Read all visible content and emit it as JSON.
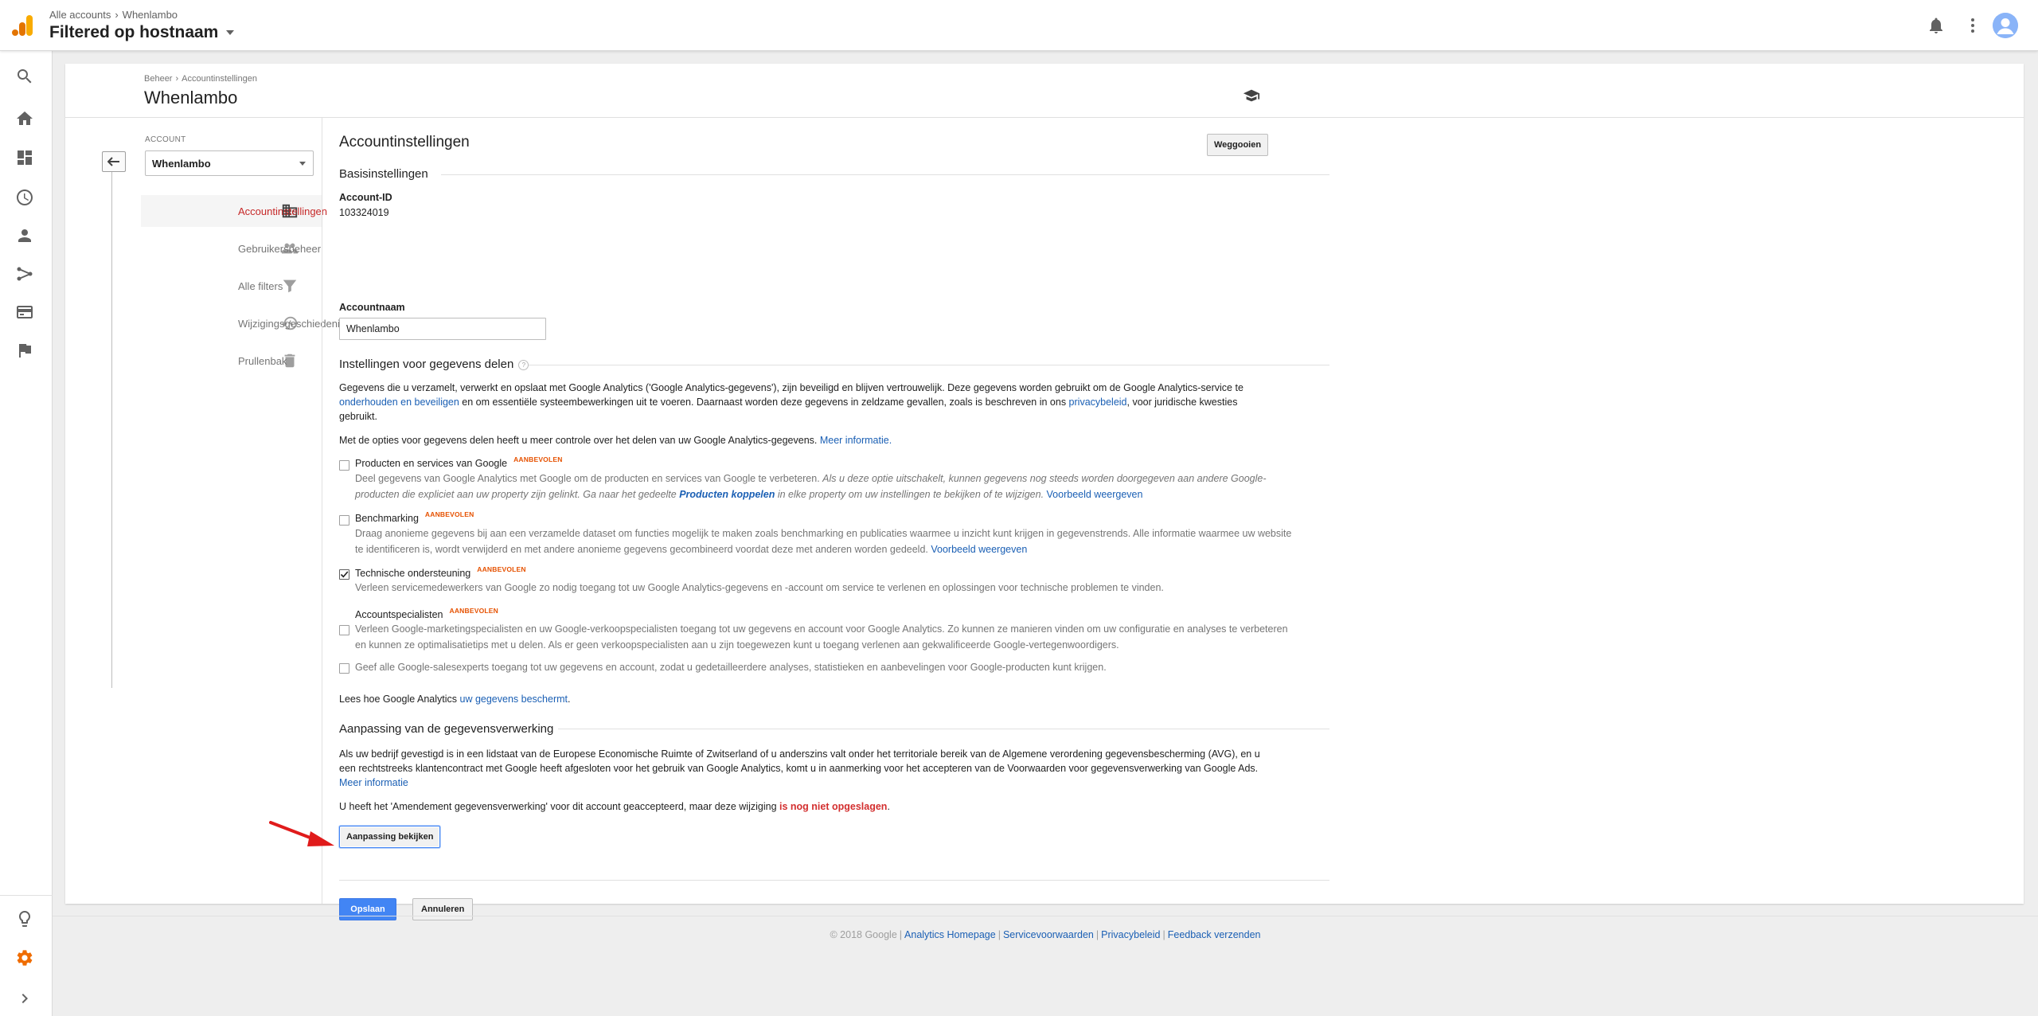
{
  "header": {
    "breadcrumb": [
      "Alle accounts",
      "Whenlambo"
    ],
    "view_title": "Filtered op hostnaam"
  },
  "admin": {
    "breadcrumb": [
      "Beheer",
      "Accountinstellingen"
    ],
    "title": "Whenlambo"
  },
  "account_column": {
    "label": "ACCOUNT",
    "selected": "Whenlambo",
    "menu": [
      {
        "label": "Accountinstellingen",
        "icon": "building-icon",
        "active": true
      },
      {
        "label": "Gebruikersbeheer",
        "icon": "users-icon",
        "active": false
      },
      {
        "label": "Alle filters",
        "icon": "filter-icon",
        "active": false
      },
      {
        "label": "Wijzigingsgeschiedenis",
        "icon": "history-icon",
        "active": false
      },
      {
        "label": "Prullenbak",
        "icon": "trash-icon",
        "active": false
      }
    ]
  },
  "settings": {
    "title": "Accountinstellingen",
    "delete_button": "Weggooien",
    "basic_section": "Basisinstellingen",
    "account_id_label": "Account-ID",
    "account_id": "103324019",
    "account_name_label": "Accountnaam",
    "account_name_value": "Whenlambo",
    "sharing_section": "Instellingen voor gegevens delen",
    "sharing_help": "?",
    "sharing_intro": {
      "part1": "Gegevens die u verzamelt, verwerkt en opslaat met Google Analytics ('Google Analytics-gegevens'), zijn beveiligd en blijven vertrouwelijk. Deze gegevens worden gebruikt om de Google Analytics-service te ",
      "link1": "onderhouden en beveiligen",
      "part2": " en om essentiële systeembewerkingen uit te voeren. Daarnaast worden deze gegevens in zeldzame gevallen, zoals is beschreven in ons ",
      "link2": "privacybeleid",
      "part3": ", voor juridische kwesties gebruikt."
    },
    "sharing_options_text": "Met de opties voor gegevens delen heeft u meer controle over het delen van uw Google Analytics-gegevens. ",
    "sharing_options_link": "Meer informatie.",
    "recommended": "AANBEVOLEN",
    "options": {
      "products": {
        "title": "Producten en services van Google",
        "checked": false,
        "desc1": "Deel gegevens van Google Analytics met Google om de producten en services van Google te verbeteren. ",
        "desc_italic1": "Als u deze optie uitschakelt, kunnen gegevens nog steeds worden doorgegeven aan andere Google-producten die expliciet aan uw property zijn gelinkt. Ga naar het gedeelte ",
        "desc_link": "Producten koppelen",
        "desc_italic2": " in elke property om uw instellingen te bekijken of te wijzigen.",
        "example_link": "Voorbeeld weergeven"
      },
      "benchmarking": {
        "title": "Benchmarking",
        "checked": false,
        "desc": "Draag anonieme gegevens bij aan een verzamelde dataset om functies mogelijk te maken zoals benchmarking en publicaties waarmee u inzicht kunt krijgen in gegevenstrends. Alle informatie waarmee uw website te identificeren is, wordt verwijderd en met andere anonieme gegevens gecombineerd voordat deze met anderen worden gedeeld. ",
        "example_link": "Voorbeeld weergeven"
      },
      "support": {
        "title": "Technische ondersteuning",
        "checked": true,
        "desc": "Verleen servicemedewerkers van Google zo nodig toegang tot uw Google Analytics-gegevens en -account om service te verlenen en oplossingen voor technische problemen te vinden."
      },
      "specialists": {
        "title": "Accountspecialisten",
        "checked": false,
        "desc": "Verleen Google-marketingspecialisten en uw Google-verkoopspecialisten toegang tot uw gegevens en account voor Google Analytics. Zo kunnen ze manieren vinden om uw configuratie en analyses te verbeteren en kunnen ze optimalisatietips met u delen. Als er geen verkoopspecialisten aan u zijn toegewezen kunt u toegang verlenen aan gekwalificeerde Google-vertegenwoordigers."
      },
      "sales_experts": {
        "checked": false,
        "desc": "Geef alle Google-salesexperts toegang tot uw gegevens en account, zodat u gedetailleerdere analyses, statistieken en aanbevelingen voor Google-producten kunt krijgen."
      }
    },
    "protection_text": "Lees hoe Google Analytics ",
    "protection_link": "uw gegevens beschermt",
    "protection_end": ".",
    "processing_section": "Aanpassing van de gegevensverwerking",
    "processing_text": "Als uw bedrijf gevestigd is in een lidstaat van de Europese Economische Ruimte of Zwitserland of u anderszins valt onder het territoriale bereik van de Algemene verordening gegevensbescherming (AVG), en u een rechtstreeks klantencontract met Google heeft afgesloten voor het gebruik van Google Analytics, komt u in aanmerking voor het accepteren van de Voorwaarden voor gegevensverwerking van Google Ads. ",
    "processing_link": "Meer informatie",
    "amendment_text": "U heeft het 'Amendement gegevensverwerking' voor dit account geaccepteerd, maar deze wijziging ",
    "amendment_warning": "is nog niet opgeslagen",
    "amendment_end": ".",
    "review_button": "Aanpassing bekijken",
    "save_button": "Opslaan",
    "cancel_button": "Annuleren"
  },
  "footer": {
    "copyright": "© 2018 Google",
    "links": [
      "Analytics Homepage",
      "Servicevoorwaarden",
      "Privacybeleid",
      "Feedback verzenden"
    ]
  },
  "colors": {
    "accent_blue": "#4285f4",
    "link_blue": "#1a5fb4",
    "active_red": "#c62828",
    "badge_orange": "#e65100",
    "logo_orange": "#f9ab00",
    "settings_gear_orange": "#ef6c00"
  }
}
